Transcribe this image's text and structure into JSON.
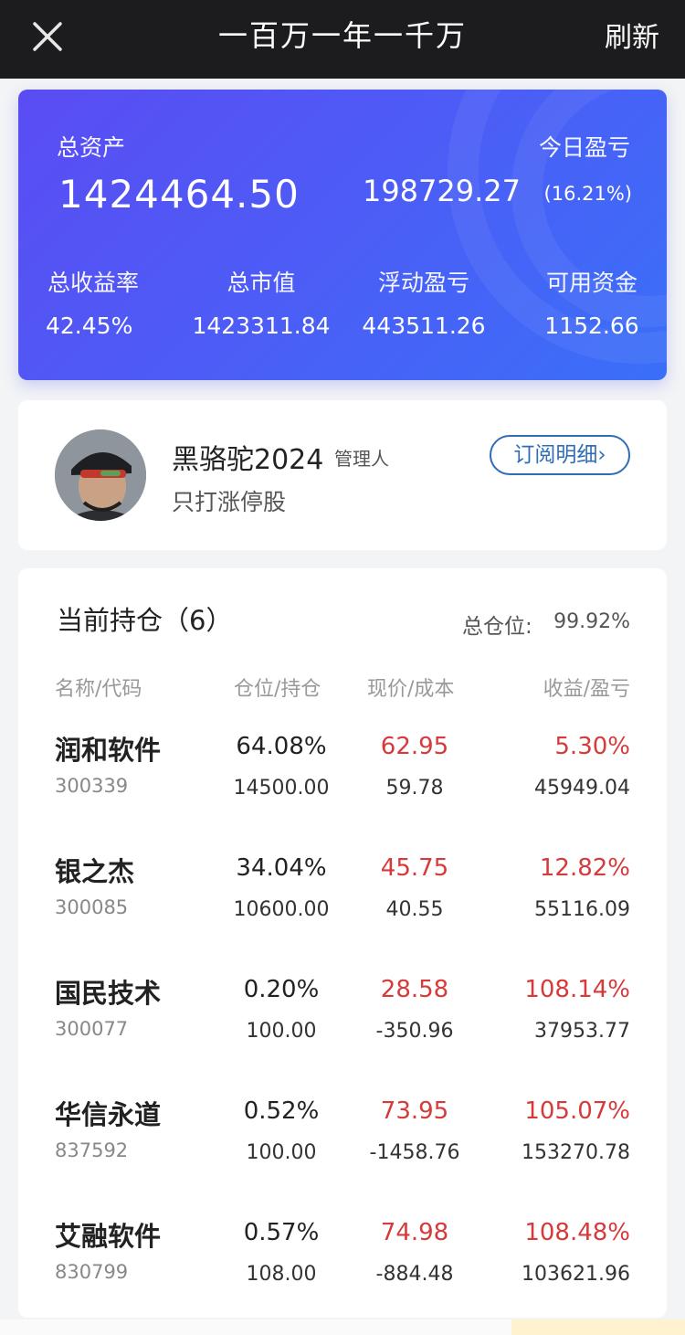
{
  "header": {
    "title": "一百万一年一千万",
    "refresh_label": "刷新"
  },
  "assets": {
    "total_label": "总资产",
    "total_value": "1424464.50",
    "today_label": "今日盈亏",
    "today_value": "198729.27",
    "today_pct": "(16.21%)",
    "stats": [
      {
        "label": "总收益率",
        "value": "42.45%"
      },
      {
        "label": "总市值",
        "value": "1423311.84"
      },
      {
        "label": "浮动盈亏",
        "value": "443511.26"
      },
      {
        "label": "可用资金",
        "value": "1152.66"
      }
    ]
  },
  "manager": {
    "name": "黑骆驼2024",
    "role": "管理人",
    "description": "只打涨停股",
    "subscribe_label": "订阅明细"
  },
  "holdings": {
    "title": "当前持仓（6）",
    "total_position_label": "总仓位:",
    "total_position_value": "99.92%",
    "columns": [
      "名称/代码",
      "仓位/持仓",
      "现价/成本",
      "收益/盈亏"
    ],
    "rows": [
      {
        "name": "润和软件",
        "code": "300339",
        "position": "64.08%",
        "shares": "14500.00",
        "price": "62.95",
        "cost": "59.78",
        "return_pct": "5.30%",
        "pnl": "45949.04"
      },
      {
        "name": "银之杰",
        "code": "300085",
        "position": "34.04%",
        "shares": "10600.00",
        "price": "45.75",
        "cost": "40.55",
        "return_pct": "12.82%",
        "pnl": "55116.09"
      },
      {
        "name": "国民技术",
        "code": "300077",
        "position": "0.20%",
        "shares": "100.00",
        "price": "28.58",
        "cost": "-350.96",
        "return_pct": "108.14%",
        "pnl": "37953.77"
      },
      {
        "name": "华信永道",
        "code": "837592",
        "position": "0.52%",
        "shares": "100.00",
        "price": "73.95",
        "cost": "-1458.76",
        "return_pct": "105.07%",
        "pnl": "153270.78"
      },
      {
        "name": "艾融软件",
        "code": "830799",
        "position": "0.57%",
        "shares": "108.00",
        "price": "74.98",
        "cost": "-884.48",
        "return_pct": "108.48%",
        "pnl": "103621.96"
      }
    ]
  },
  "colors": {
    "topbar": "#1c1c1e",
    "card_gradient_start": "#5a4cf3",
    "card_gradient_end": "#3a6ff8",
    "gain_red": "#d63a3a",
    "link_blue": "#2f6db5"
  },
  "icons": {
    "close": "close-icon",
    "chevron": "chevron-right-icon"
  }
}
